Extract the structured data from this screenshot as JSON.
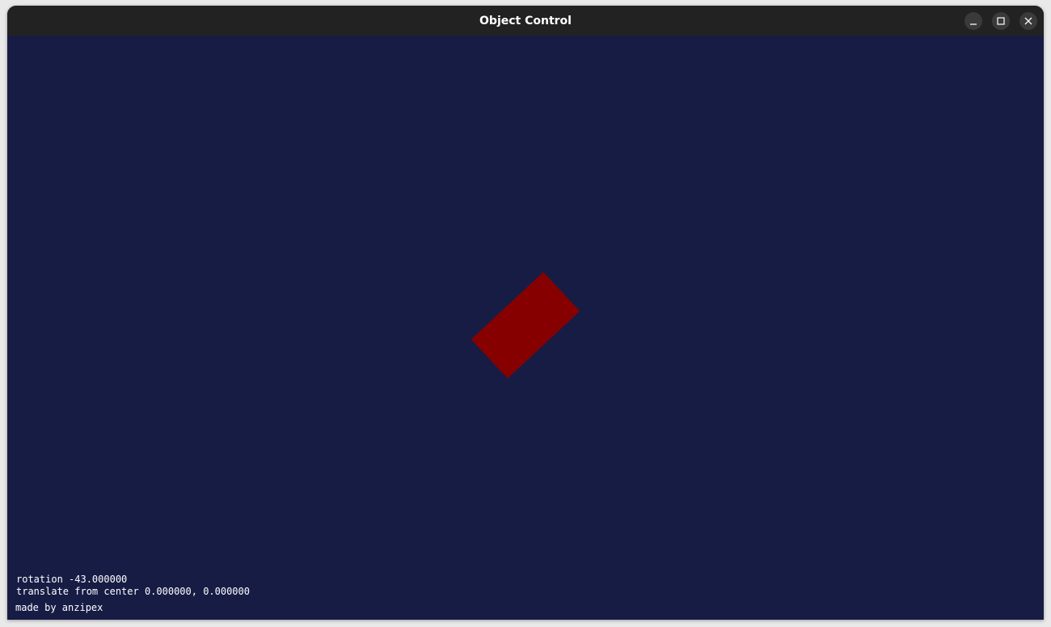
{
  "window": {
    "title": "Object Control"
  },
  "controls": {
    "minimize_icon": "minimize-icon",
    "maximize_icon": "maximize-icon",
    "close_icon": "close-icon"
  },
  "scene": {
    "background_color": "#171c45",
    "object_color": "#870000",
    "rotation_degrees": -43,
    "translate": [
      0,
      0
    ]
  },
  "hud": {
    "rotation_text": "rotation -43.000000",
    "translate_text": "translate from center 0.000000, 0.000000",
    "credit_text": "made by anzipex"
  }
}
